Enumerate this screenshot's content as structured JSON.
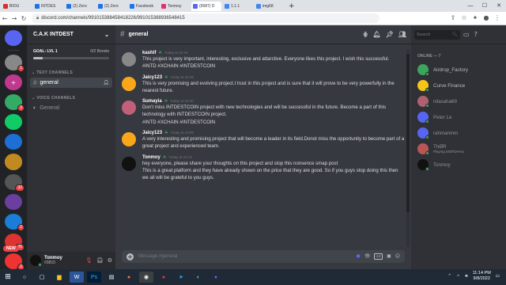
{
  "browser": {
    "tabs": [
      {
        "label": "BIOU",
        "color": "#d93025",
        "active": false
      },
      {
        "label": "INTDES",
        "color": "#1a73e8",
        "active": false
      },
      {
        "label": "(2) Zero",
        "color": "#1a73e8",
        "active": false
      },
      {
        "label": "(2) Zero",
        "color": "#1a73e8",
        "active": false
      },
      {
        "label": "Facebook",
        "color": "#1877f2",
        "active": false
      },
      {
        "label": "Tonmoy",
        "color": "#e1306c",
        "active": false
      },
      {
        "label": "(9587) D",
        "color": "#5865f2",
        "active": true
      },
      {
        "label": "1.1.1",
        "color": "#4285f4",
        "active": false
      },
      {
        "label": "img68",
        "color": "#4285f4",
        "active": false
      }
    ],
    "new_tab": "+",
    "url": "discord.com/channels/991015388458418226/991015388936548415"
  },
  "guilds": [
    {
      "initial": "",
      "color": "#5865f2",
      "badge": ""
    },
    {
      "initial": "",
      "color": "#888",
      "badge": "1"
    },
    {
      "initial": "+",
      "color": "#c0398f",
      "badge": ""
    },
    {
      "initial": "",
      "color": "#3a6",
      "badge": "3"
    },
    {
      "initial": "",
      "color": "#1c6",
      "badge": ""
    },
    {
      "initial": "",
      "color": "#1d6fd6",
      "badge": ""
    },
    {
      "initial": "",
      "color": "#c08a20",
      "badge": ""
    },
    {
      "initial": "",
      "color": "#555",
      "badge": "32"
    },
    {
      "initial": "",
      "color": "#6b3fa0",
      "badge": ""
    },
    {
      "initial": "",
      "color": "#1b7dd8",
      "badge": "2"
    },
    {
      "initial": "",
      "color": "#d33",
      "badge": "25"
    },
    {
      "initial": "",
      "color": "#e33",
      "badge": "2"
    }
  ],
  "new_label": "NEW",
  "server": {
    "name": "C.A.K INTDEST",
    "goal_label": "GOAL: LVL 1",
    "goal_count": "0/2 Boosts",
    "goal_progress": 0.12,
    "text_category": "TEXT CHANNELS",
    "text_channel": "general",
    "voice_category": "VOICE CHANNELS",
    "voice_channel": "General"
  },
  "user": {
    "name": "Tonmoy",
    "tag": "#3810"
  },
  "channel_header": {
    "name": "general"
  },
  "messages": [
    {
      "author": "kashif",
      "time": "Today at 22:44",
      "avatar_color": "#888",
      "text": "This project is very important, interesting, exclusive and attarctive. Everyone likes this project. I wish this successful.\n#INTD #XCHAIN  #INTDESTCOIN"
    },
    {
      "author": "Jaicy123",
      "time": "Today at 22:45",
      "avatar_color": "#faa61a",
      "text": "This is very promising and evolving project.I trust in this project and is sure that it will prove to be very powerfully in the nearest future."
    },
    {
      "author": "Sumayia",
      "time": "Today at 23:00",
      "avatar_color": "#c2607a",
      "text": "Don't miss INTDESTCOIN project with new technologies and will be successful in the future. Become a part of this technology with INTDESTCOIN project.\n#INTD #XCHAIN   #INTDESTCOIN"
    },
    {
      "author": "Jaicy123",
      "time": "Today at 23:00",
      "avatar_color": "#faa61a",
      "text": "A very interesting and promising project that will become a leader in its field.Donot miss the opportunity to become part of a great project and experienced team."
    },
    {
      "author": "Tonmoy",
      "time": "Today at 23:12",
      "avatar_color": "#111",
      "text": "hey everyone, please share your thoughts on this project and stop this nonsence smap post\nThis is a great platform and they have already shown on the price that they are good. So if you guys stop doing this then we all will be grateful to you guys."
    }
  ],
  "composer": {
    "placeholder": "Message #general",
    "gift": "GIF"
  },
  "members": {
    "search_placeholder": "Search",
    "category": "ONLINE — 7",
    "list": [
      {
        "name": "Airdrop_Factory",
        "status": "",
        "color": "#3ba55d"
      },
      {
        "name": "Curve Finance",
        "status": "",
        "color": "#f5c518"
      },
      {
        "name": "nilasaha69",
        "status": "",
        "color": "#b06070"
      },
      {
        "name": "Peter Le",
        "status": "",
        "color": "#5865f2"
      },
      {
        "name": "rahmanmm",
        "status": "",
        "color": "#5865f2"
      },
      {
        "name": "ThØR",
        "status": "Playing MORDHAU",
        "color": "#b55"
      },
      {
        "name": "Tonmoy",
        "status": "",
        "color": "#111"
      }
    ]
  },
  "taskbar": {
    "time": "11:14 PM",
    "date": "9/8/2022"
  }
}
